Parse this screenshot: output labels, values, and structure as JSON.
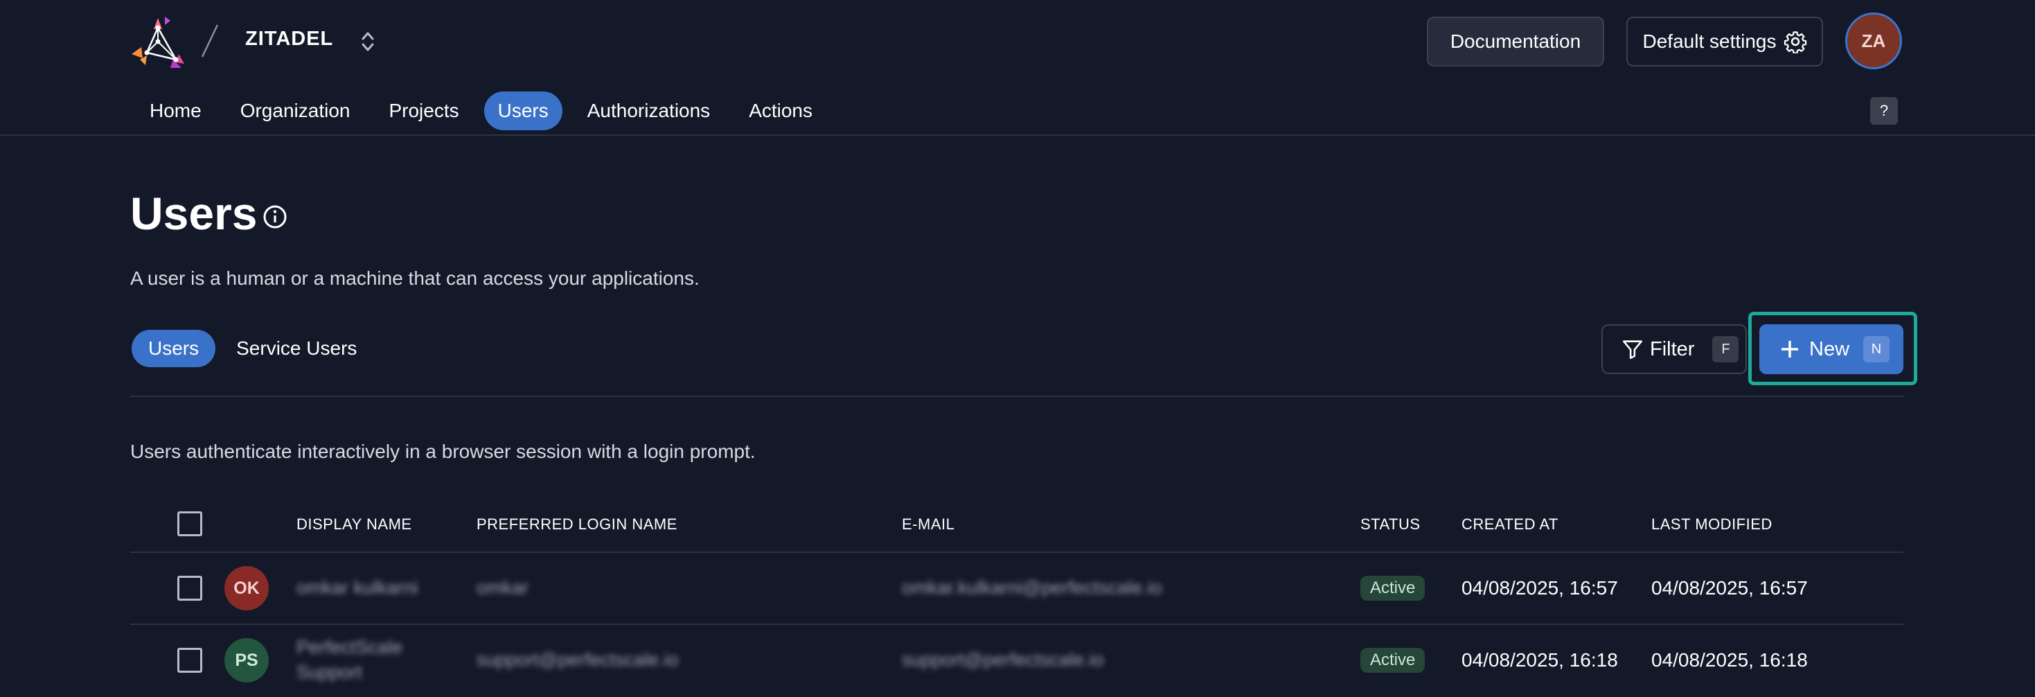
{
  "header": {
    "org_name": "ZITADEL",
    "documentation_label": "Documentation",
    "default_settings_label": "Default settings",
    "user_initials": "ZA",
    "help_label": "?"
  },
  "nav": {
    "items": [
      {
        "label": "Home"
      },
      {
        "label": "Organization"
      },
      {
        "label": "Projects"
      },
      {
        "label": "Users",
        "active": true
      },
      {
        "label": "Authorizations"
      },
      {
        "label": "Actions"
      }
    ]
  },
  "page": {
    "title": "Users",
    "description": "A user is a human or a machine that can access your applications."
  },
  "tabs": {
    "users_label": "Users",
    "service_users_label": "Service Users"
  },
  "toolbar": {
    "filter_label": "Filter",
    "filter_shortcut": "F",
    "new_label": "New",
    "new_shortcut": "N"
  },
  "list": {
    "description": "Users authenticate interactively in a browser session with a login prompt.",
    "columns": {
      "display_name": "DISPLAY NAME",
      "preferred_login_name": "PREFERRED LOGIN NAME",
      "email": "E-MAIL",
      "status": "STATUS",
      "created_at": "CREATED AT",
      "last_modified": "LAST MODIFIED"
    },
    "rows": [
      {
        "initials": "OK",
        "avatar_color": "#8a2a26",
        "display_name": "omkar kulkarni",
        "login_name": "omkar",
        "email": "omkar.kulkarni@perfectscale.io",
        "status": "Active",
        "created_at": "04/08/2025, 16:57",
        "last_modified": "04/08/2025, 16:57"
      },
      {
        "initials": "PS",
        "avatar_color": "#23553f",
        "display_name": "PerfectScale Support",
        "login_name": "support@perfectscale.io",
        "email": "support@perfectscale.io",
        "status": "Active",
        "created_at": "04/08/2025, 16:18",
        "last_modified": "04/08/2025, 16:18"
      }
    ]
  },
  "colors": {
    "background": "#131928",
    "accent": "#3b72c9",
    "highlight": "#1ea99a"
  }
}
